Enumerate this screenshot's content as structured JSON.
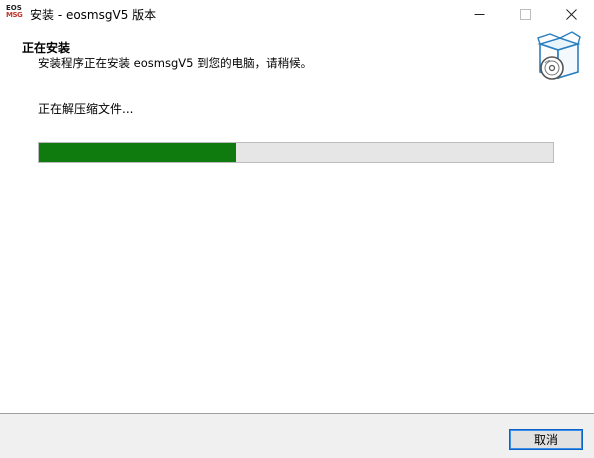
{
  "window": {
    "title": "安装 - eosmsgV5 版本",
    "logo_line1": "EOS",
    "logo_line2": "MSG",
    "controls": {
      "minimize_icon": "minimize-icon",
      "maximize_icon": "maximize-icon",
      "close_icon": "close-icon"
    }
  },
  "header": {
    "title": "正在安装",
    "subtitle": "安装程序正在安装 eosmsgV5 到您的电脑，请稍候。",
    "icon": "install-box-icon"
  },
  "main": {
    "status": "正在解压缩文件...",
    "progress_fraction": 0.383,
    "progress_color": "#0f7b0f"
  },
  "footer": {
    "cancel_label": "取消"
  }
}
